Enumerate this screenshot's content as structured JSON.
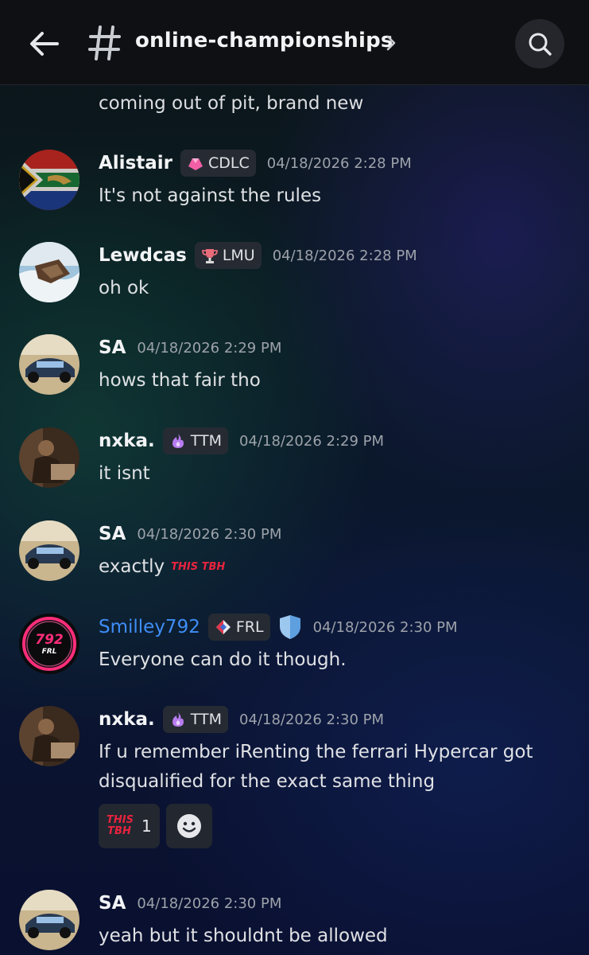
{
  "header": {
    "channel": "online-championships"
  },
  "feed": {
    "continuation": "coming out of pit, brand new",
    "messages": [
      {
        "author": "Alistair",
        "tag": "CDLC",
        "time": "04/18/2026 2:28 PM",
        "text": "It's not against the rules"
      },
      {
        "author": "Lewdcas",
        "tag": "LMU",
        "time": "04/18/2026 2:28 PM",
        "text": "oh ok"
      },
      {
        "author": "SA",
        "time": "04/18/2026 2:29 PM",
        "text": "hows that fair tho"
      },
      {
        "author": "nxka.",
        "tag": "TTM",
        "time": "04/18/2026 2:29 PM",
        "text": "it isnt"
      },
      {
        "author": "SA",
        "time": "04/18/2026 2:30 PM",
        "text": "exactly",
        "emoji": "THIS TBH"
      },
      {
        "author": "Smilley792",
        "tag": "FRL",
        "avatar_text": "792",
        "avatar_sub": "FRL",
        "time": "04/18/2026 2:30 PM",
        "text": "Everyone can do it though."
      },
      {
        "author": "nxka.",
        "tag": "TTM",
        "time": "04/18/2026 2:30 PM",
        "text_line1": "If u remember iRenting the ferrari Hypercar got",
        "text_line2": "disqualified for the exact same thing"
      },
      {
        "author": "SA",
        "time": "04/18/2026 2:30 PM",
        "text": "yeah but it shouldnt be allowed"
      }
    ],
    "reaction": {
      "emoji": "THIS TBH",
      "count": "1"
    }
  },
  "colors": {
    "accent_blue": "#3f8df6",
    "timestamp": "#9da2aa",
    "tag_bg": "#262b33"
  },
  "icons": [
    "back-arrow-icon",
    "hash-icon",
    "chevron-right-icon",
    "search-icon",
    "add-reaction-icon",
    "moderator-shield-icon"
  ]
}
